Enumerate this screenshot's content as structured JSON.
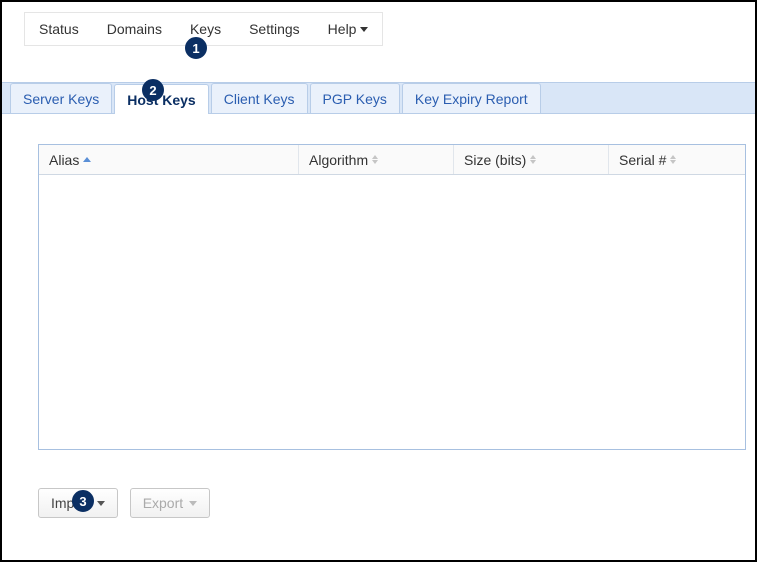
{
  "topnav": {
    "items": [
      {
        "label": "Status"
      },
      {
        "label": "Domains"
      },
      {
        "label": "Keys"
      },
      {
        "label": "Settings"
      },
      {
        "label": "Help",
        "dropdown": true
      }
    ]
  },
  "tabs": [
    {
      "label": "Server Keys",
      "active": false
    },
    {
      "label": "Host Keys",
      "active": true
    },
    {
      "label": "Client Keys",
      "active": false
    },
    {
      "label": "PGP Keys",
      "active": false
    },
    {
      "label": "Key Expiry Report",
      "active": false
    }
  ],
  "table": {
    "columns": [
      {
        "label": "Alias",
        "sort": "asc"
      },
      {
        "label": "Algorithm",
        "sort": "both"
      },
      {
        "label": "Size (bits)",
        "sort": "both"
      },
      {
        "label": "Serial #",
        "sort": "both"
      }
    ],
    "rows": []
  },
  "buttons": {
    "import_label": "Import",
    "export_label": "Export"
  },
  "callouts": {
    "c1": "1",
    "c2": "2",
    "c3": "3"
  }
}
